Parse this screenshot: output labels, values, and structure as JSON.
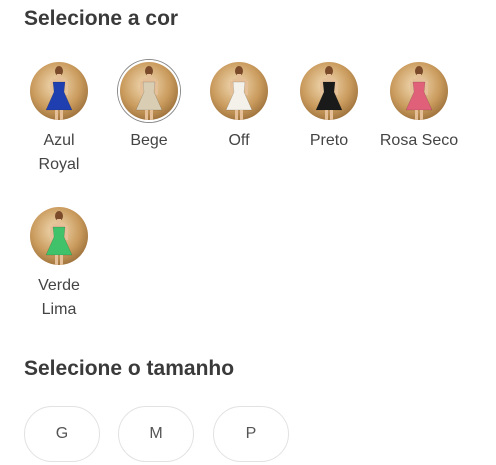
{
  "color_section": {
    "title": "Selecione a cor",
    "options": [
      {
        "label": "Azul Royal",
        "color": "#1f3fb0",
        "selected": false
      },
      {
        "label": "Bege",
        "color": "#d9cdb4",
        "selected": true
      },
      {
        "label": "Off",
        "color": "#f3f1ea",
        "selected": false
      },
      {
        "label": "Preto",
        "color": "#1a1a1a",
        "selected": false
      },
      {
        "label": "Rosa Seco",
        "color": "#e0607a",
        "selected": false
      },
      {
        "label": "Verde Lima",
        "color": "#3fc26a",
        "selected": false
      }
    ]
  },
  "size_section": {
    "title": "Selecione o tamanho",
    "options": [
      "G",
      "M",
      "P"
    ]
  }
}
